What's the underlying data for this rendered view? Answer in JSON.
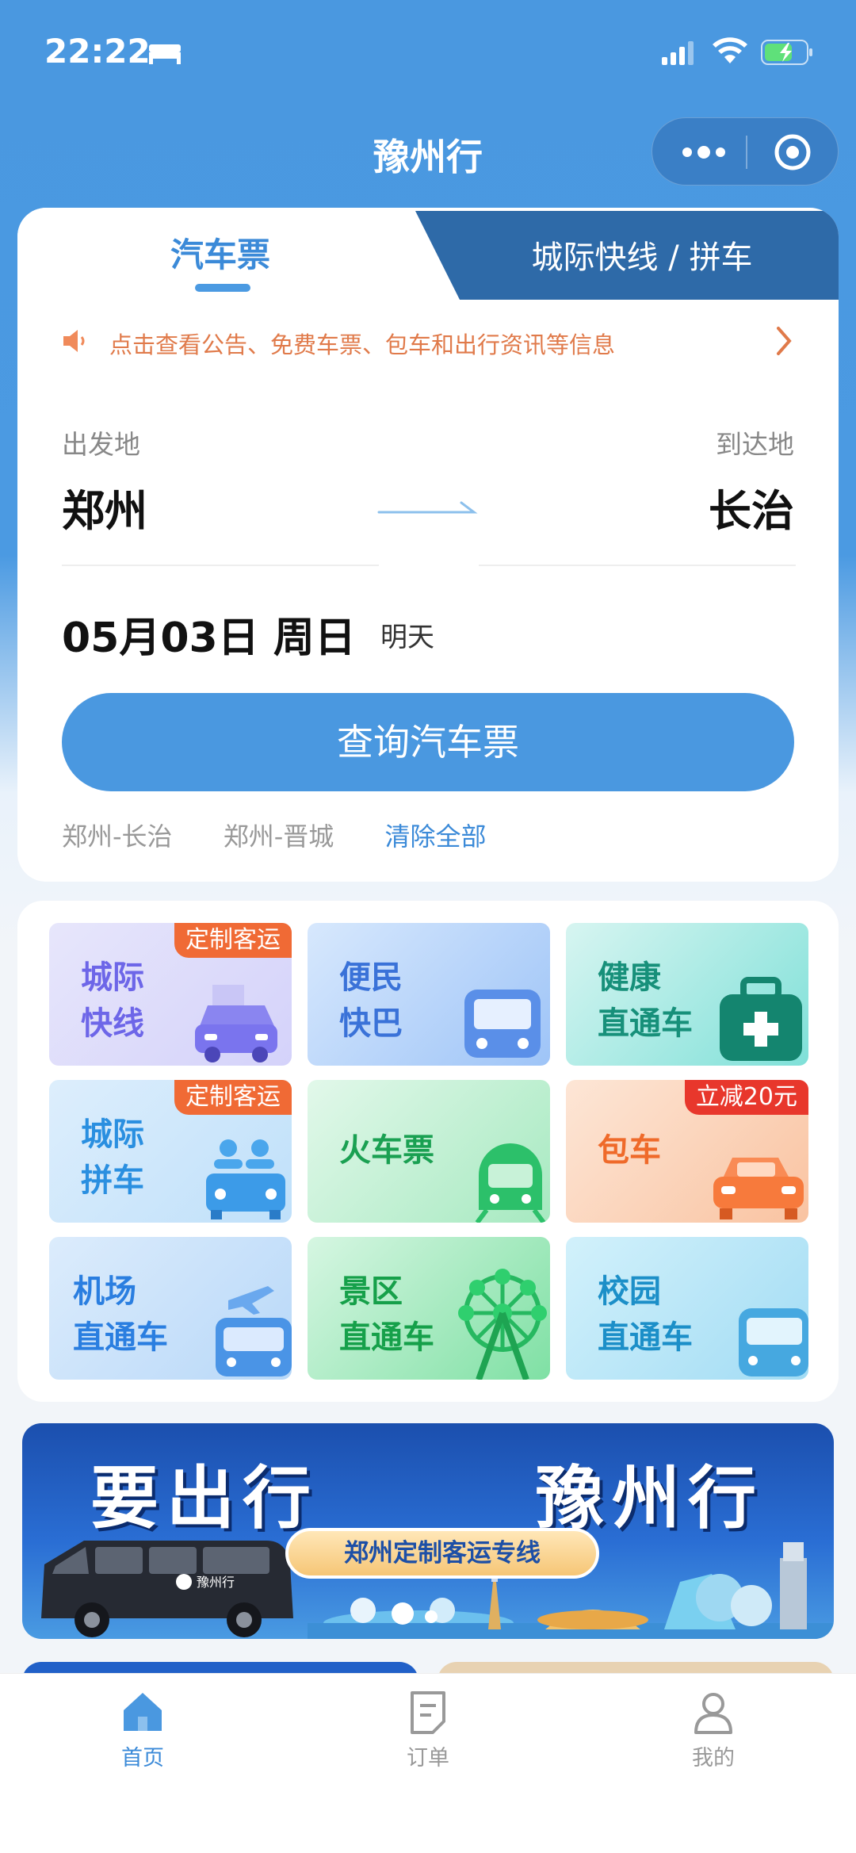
{
  "status_bar": {
    "time": "22:22"
  },
  "nav": {
    "title": "豫州行"
  },
  "tabs": {
    "bus": "汽车票",
    "intercity": "城际快线 / 拼车"
  },
  "notice": {
    "text": "点击查看公告、免费车票、包车和出行资讯等信息"
  },
  "route": {
    "from_label": "出发地",
    "from_city": "郑州",
    "to_label": "到达地",
    "to_city": "长治"
  },
  "date": {
    "value": "05月03日 周日",
    "relative": "明天"
  },
  "search_button": "查询汽车票",
  "history": {
    "items": [
      "郑州-长治",
      "郑州-晋城"
    ],
    "clear": "清除全部"
  },
  "services": [
    {
      "line1": "城际",
      "line2": "快线",
      "badge": "定制客运"
    },
    {
      "line1": "便民",
      "line2": "快巴"
    },
    {
      "line1": "健康",
      "line2": "直通车"
    },
    {
      "line1": "城际",
      "line2": "拼车",
      "badge": "定制客运"
    },
    {
      "line1": "火车票"
    },
    {
      "line1": "包车",
      "badge": "立减20元"
    },
    {
      "line1": "机场",
      "line2": "直通车"
    },
    {
      "line1": "景区",
      "line2": "直通车"
    },
    {
      "line1": "校园",
      "line2": "直通车"
    }
  ],
  "banner": {
    "left": "要出行",
    "right": "豫州行",
    "pill": "郑州定制客运专线",
    "van_brand": "豫州行"
  },
  "bottom_nav": [
    {
      "label": "首页"
    },
    {
      "label": "订单"
    },
    {
      "label": "我的"
    }
  ],
  "colors": {
    "primary": "#4a98e0",
    "accent_orange": "#f06a35",
    "notice_orange": "#e07a4a"
  }
}
